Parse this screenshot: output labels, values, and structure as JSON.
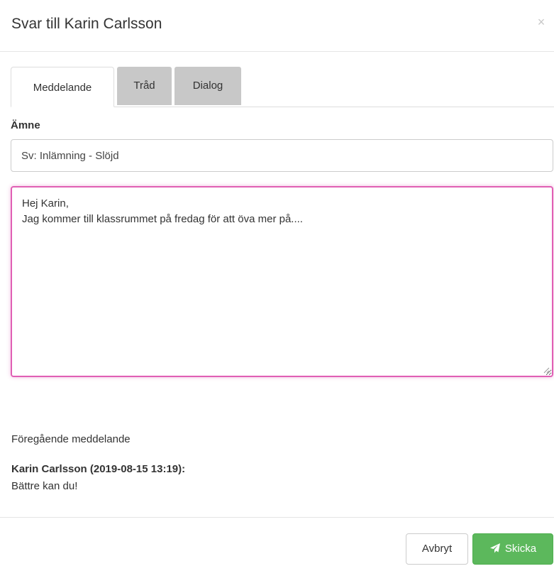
{
  "modal": {
    "title": "Svar till Karin Carlsson",
    "close_symbol": "×"
  },
  "tabs": [
    {
      "label": "Meddelande",
      "active": true
    },
    {
      "label": "Tråd",
      "active": false
    },
    {
      "label": "Dialog",
      "active": false
    }
  ],
  "form": {
    "subject_label": "Ämne",
    "subject_value": "Sv: Inlämning - Slöjd",
    "message_lines": [
      "Hej Karin,",
      "Jag kommer till klassrummet på fredag för att öva mer på...."
    ]
  },
  "previous": {
    "heading": "Föregående meddelande",
    "author_line": "Karin Carlsson (2019-08-15 13:19):",
    "body": "Bättre kan du!"
  },
  "footer": {
    "cancel_label": "Avbryt",
    "send_label": "Skicka",
    "send_icon": "paper-plane-icon"
  },
  "colors": {
    "send_button": "#5cb85c",
    "focus_border": "#e05fb4",
    "inactive_tab": "#c8c8c8"
  }
}
